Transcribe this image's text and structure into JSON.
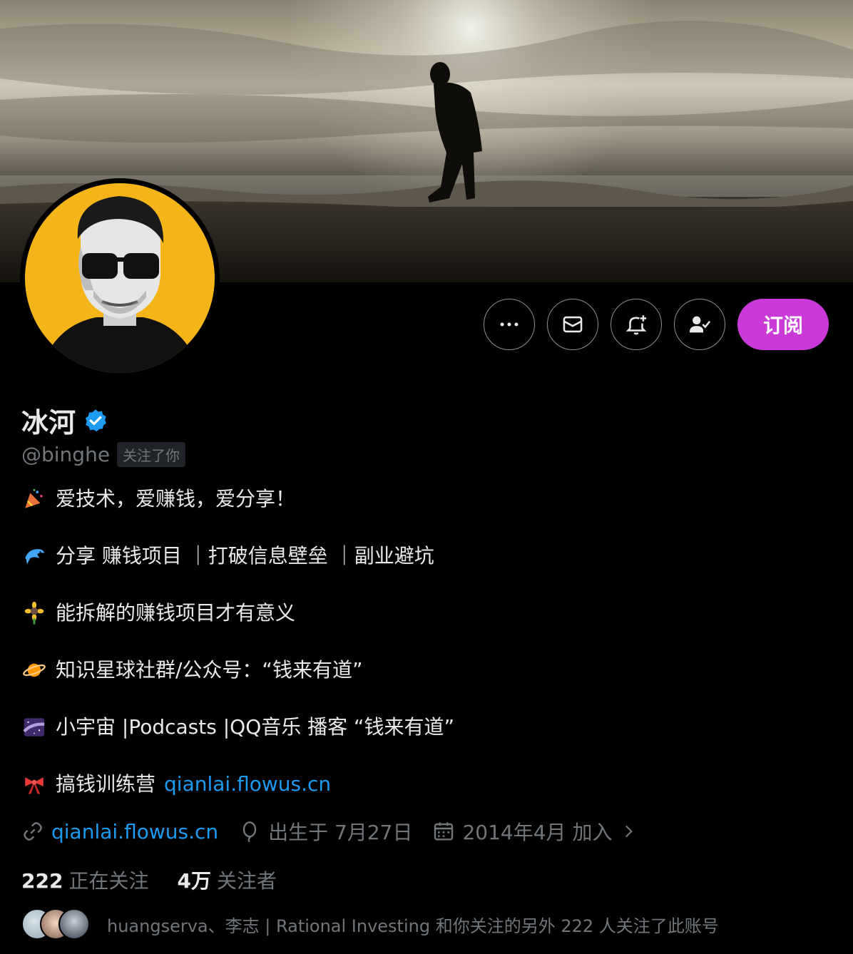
{
  "profile": {
    "name": "冰河",
    "handle": "@binghe",
    "follows_you": "关注了你"
  },
  "actions": {
    "subscribe_label": "订阅",
    "more_icon": "more-icon",
    "message_icon": "mail-icon",
    "notify_icon": "bell-plus-icon",
    "following_icon": "person-check-icon"
  },
  "bio": {
    "line1": "爱技术，爱赚钱，爱分享！",
    "line2": "分享 赚钱项目 ｜打破信息壁垒 ｜副业避坑",
    "line3": "能拆解的赚钱项目才有意义",
    "line4": "知识星球社群/公众号：“钱来有道”",
    "line5": "小宇宙 |Podcasts |QQ音乐  播客 “钱来有道”",
    "line6_text": "搞钱训练营",
    "line6_link": "qianlai.flowus.cn"
  },
  "meta": {
    "website": "qianlai.flowus.cn",
    "birthday": "出生于 7月27日",
    "joined": "2014年4月 加入"
  },
  "stats": {
    "following_count": "222",
    "following_label": "正在关注",
    "followers_count": "4万",
    "followers_label": "关注者"
  },
  "followed_by": "huangserva、李志 | Rational Investing 和你关注的另外 222 人关注了此账号",
  "colors": {
    "accent": "#1d9bf0",
    "subscribe": "#c93ad8",
    "avatar_bg": "#f5b418"
  }
}
